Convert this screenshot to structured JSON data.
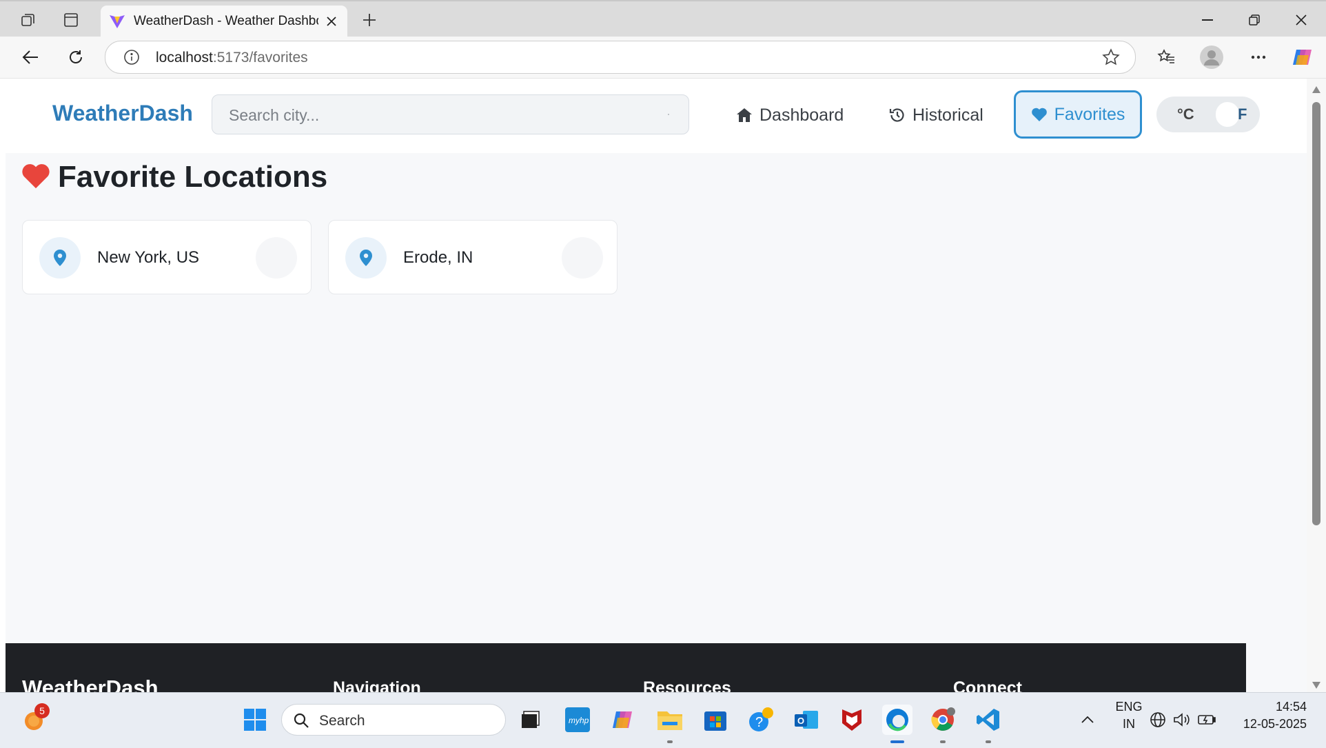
{
  "browser": {
    "tab_title": "WeatherDash - Weather Dashboard",
    "address_host": "localhost",
    "address_path": ":5173/favorites"
  },
  "header": {
    "logo": "WeatherDash",
    "search_placeholder": "Search city...",
    "nav": [
      {
        "label": "Dashboard",
        "icon": "home-icon",
        "active": false
      },
      {
        "label": "Historical",
        "icon": "history-icon",
        "active": false
      },
      {
        "label": "Favorites",
        "icon": "heart-icon",
        "active": true
      }
    ],
    "unit_toggle": {
      "left": "°C",
      "right": "F",
      "selected": "F"
    }
  },
  "page": {
    "title": "Favorite Locations",
    "favorites": [
      {
        "name": "New York, US"
      },
      {
        "name": "Erode, IN"
      }
    ]
  },
  "footer": {
    "brand": "WeatherDash",
    "columns": [
      "Navigation",
      "Resources",
      "Connect"
    ]
  },
  "taskbar": {
    "search_placeholder": "Search",
    "notification_count": "5",
    "language": "ENG",
    "region": "IN",
    "time": "14:54",
    "date": "12-05-2025"
  },
  "colors": {
    "brand": "#2e7cb8",
    "accent": "#2e8fd0",
    "heart": "#e8453c",
    "footer_bg": "#1f2125"
  }
}
